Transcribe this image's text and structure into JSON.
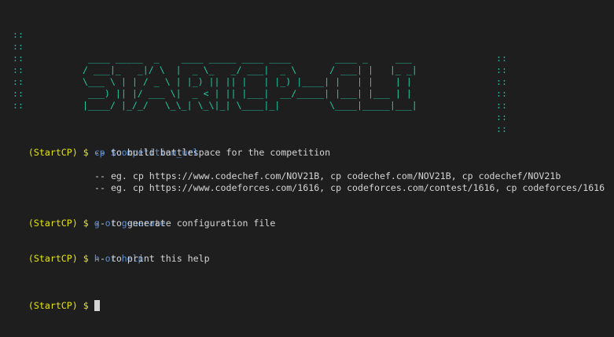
{
  "banner": {
    "art_lines": [
      "",
      " ____ _____  _    ____ _____ ____ ____        ____ _     ___",
      "/ ___|_   _|/ \\  |  _ \\_   _/ ___|  _ \\      / ___| |   |_ _|",
      "\\___ \\ | | / _ \\ | |_) || || |   | |_) |____| |   | |    | |",
      " ___) || |/ ___ \\|  _ < | || |___|  __/_____| |___| |___ | |",
      "|____/ |_/_/   \\_\\_| \\_\\|_| \\____|_|         \\____|_____|___|",
      ""
    ],
    "border_char": "::",
    "color": "#1ec9a0"
  },
  "prompt": "(StartCP) $",
  "commands": [
    {
      "command": "cp $competition_url",
      "descriptions": [
        "-- to build battlespace for the competition",
        "",
        "-- eg. cp https://www.codechef.com/NOV21B, cp codechef.com/NOV21B, cp codechef/NOV21b",
        "-- eg. cp https://www.codeforces.com/1616, cp codeforces.com/contest/1616, cp codeforces/1616"
      ]
    },
    {
      "command": "g or generate",
      "descriptions": [
        "-- to generate configuration file"
      ]
    },
    {
      "command": "h or help",
      "descriptions": [
        "-- to print this help"
      ]
    }
  ],
  "input_prompt": "(StartCP) $",
  "colors": {
    "background": "#1e1e1e",
    "prompt": "#e5e510",
    "command": "#5b8fd6",
    "text": "#d4d4d4"
  }
}
